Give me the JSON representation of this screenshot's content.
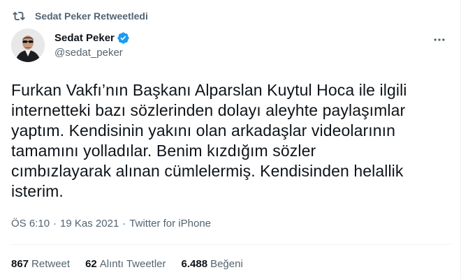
{
  "retweet_banner": {
    "icon": "retweet-icon",
    "text": "Sedat Peker Retweetledi"
  },
  "author": {
    "name": "Sedat Peker",
    "handle": "@sedat_peker",
    "verified": true
  },
  "tweet": {
    "lines": [
      "Furkan Vakfı’nın Başkanı Alparslan Kuytul Hoca ile ilgili",
      "internetteki bazı sözlerinden dolayı aleyhte paylaşımlar",
      "yaptım. Kendisinin yakını olan arkadaşlar videolarının",
      "tamamını yolladılar. Benim kızdığım sözler",
      "cımbızlayarak alınan cümlelermiş. Kendisinden helallik",
      "isterim."
    ]
  },
  "meta": {
    "time": "ÖS 6:10",
    "date": "19 Kas 2021",
    "separator": "·",
    "source": "Twitter for iPhone"
  },
  "stats": [
    {
      "count": "867",
      "label": "Retweet"
    },
    {
      "count": "62",
      "label": "Alıntı Tweetler"
    },
    {
      "count": "6.488",
      "label": "Beğeni"
    }
  ],
  "colors": {
    "text": "#0f1419",
    "secondary": "#536471",
    "verified": "#1d9bf0",
    "divider": "#eff3f4"
  }
}
